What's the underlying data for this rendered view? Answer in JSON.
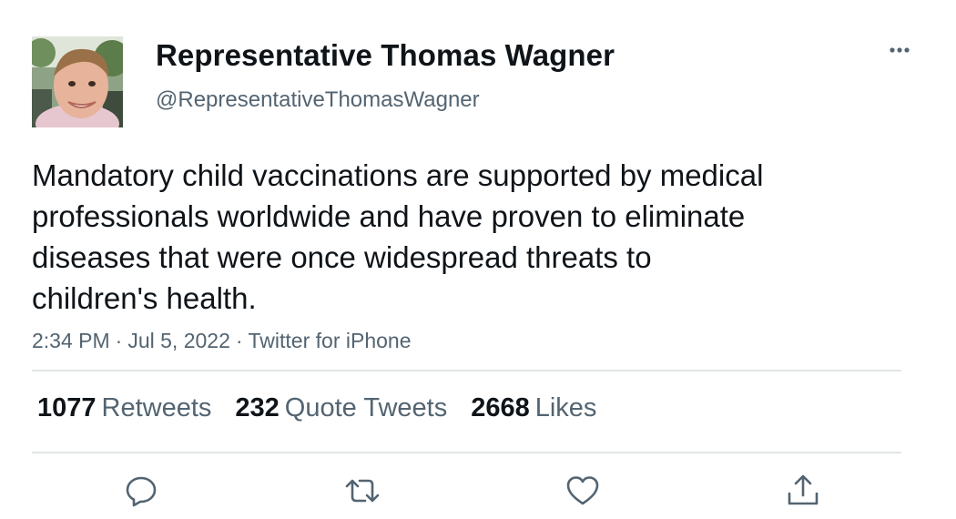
{
  "author": {
    "display_name": "Representative Thomas Wagner",
    "handle": "@RepresentativeThomasWagner"
  },
  "tweet": {
    "text_lines": [
      "Mandatory child vaccinations are supported by medical",
      "professionals worldwide and have proven to eliminate",
      "diseases that were once widespread threats to",
      "children's health."
    ],
    "time": "2:34 PM",
    "date": "Jul 5, 2022",
    "source": "Twitter for iPhone",
    "separator": "·"
  },
  "stats": {
    "retweets_count": "1077",
    "retweets_label": "Retweets",
    "quotes_count": "232",
    "quotes_label": "Quote Tweets",
    "likes_count": "2668",
    "likes_label": "Likes"
  },
  "icons": {
    "more": "more-horizontal-icon",
    "reply": "reply-icon",
    "retweet": "retweet-icon",
    "like": "heart-icon",
    "share": "share-icon"
  },
  "colors": {
    "primary_text": "#0f1419",
    "secondary_text": "#536471",
    "divider": "#e1e4e6"
  }
}
